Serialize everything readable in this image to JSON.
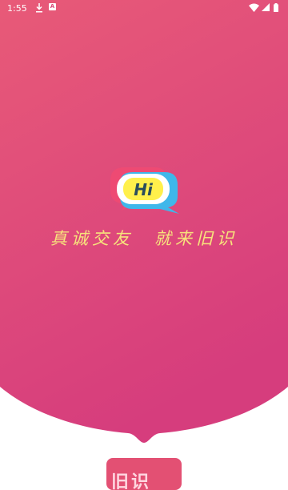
{
  "status_bar": {
    "time": "1:55",
    "icons": [
      "download-icon",
      "a-icon",
      "wifi-icon",
      "cell-signal-icon",
      "battery-icon"
    ]
  },
  "splash": {
    "logo_text": "Hi",
    "slogan_left": "真诚交友",
    "slogan_right": "就来旧识",
    "bottom_card_text": "旧识"
  },
  "colors": {
    "gradient_top": "#e85a78",
    "gradient_bottom": "#d73f7c",
    "slogan": "#f7e37c",
    "logo_pink": "#ee4a73",
    "logo_blue": "#3fb7ea",
    "logo_yellow": "#fff04b"
  }
}
